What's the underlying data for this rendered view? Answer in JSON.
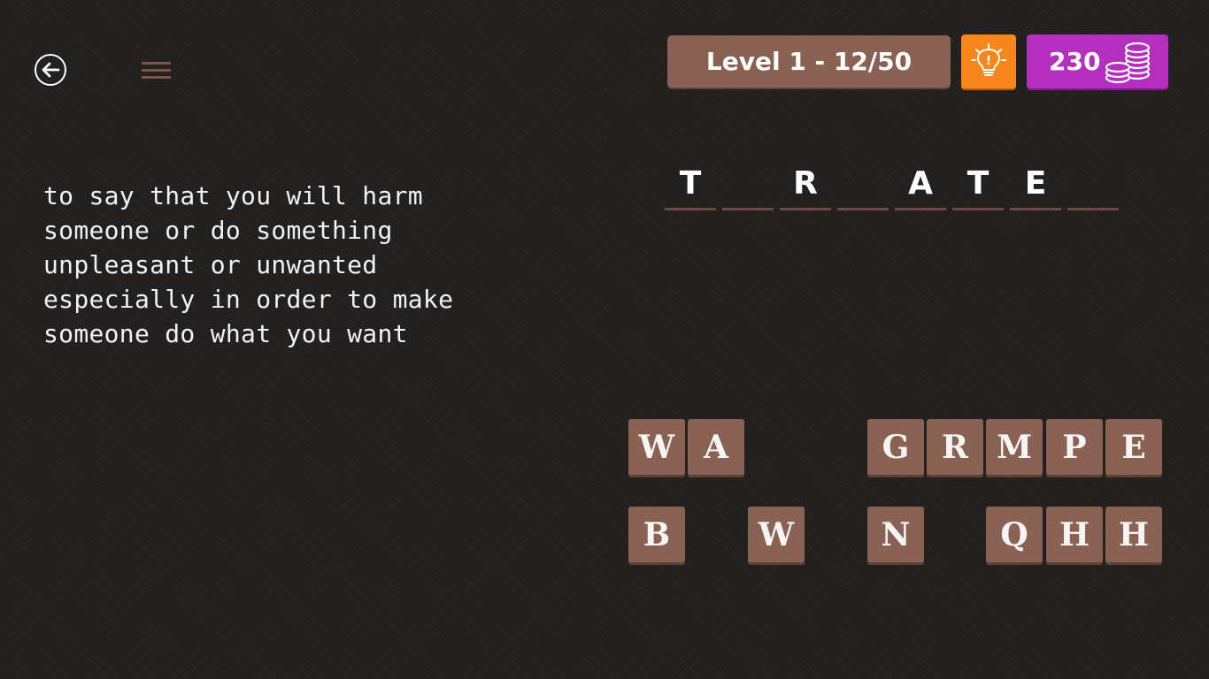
{
  "header": {
    "back_icon": "arrow-left-circle-icon",
    "menu_icon": "hamburger-menu-icon",
    "level_label": "Level 1 - 12/50",
    "hint_icon": "lightbulb-icon",
    "coins_count": "230",
    "coins_icon": "coin-stack-icon"
  },
  "clue": {
    "lines": [
      "to say that you will harm",
      "someone or do something",
      "unpleasant or unwanted",
      "especially in order to make",
      "someone do what you want"
    ]
  },
  "answer": {
    "slots": [
      "T",
      "",
      "R",
      "",
      "A",
      "T",
      "E",
      ""
    ]
  },
  "tiles": {
    "row1": [
      "W",
      "A",
      "",
      "",
      "G",
      "R",
      "M",
      "P",
      "E"
    ],
    "row2": [
      "B",
      "",
      "W",
      "",
      "N",
      "",
      "Q",
      "H",
      "H"
    ]
  },
  "colors": {
    "background": "#222120",
    "tile": "#8a6253",
    "hint": "#f7861c",
    "coins": "#b52fbf",
    "slot_underline": "#6b4a3f"
  }
}
